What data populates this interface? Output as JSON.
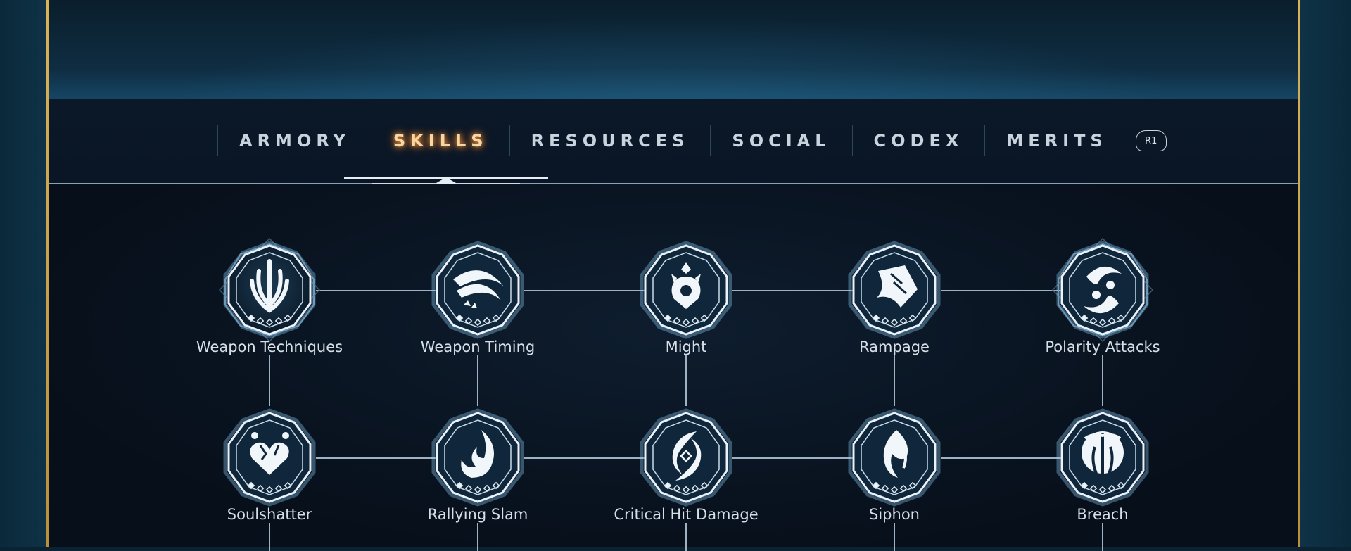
{
  "nav": {
    "tabs": [
      {
        "label": "ARMORY",
        "active": false
      },
      {
        "label": "SKILLS",
        "active": true
      },
      {
        "label": "RESOURCES",
        "active": false
      },
      {
        "label": "SOCIAL",
        "active": false
      },
      {
        "label": "CODEX",
        "active": false
      },
      {
        "label": "MERITS",
        "active": false
      }
    ],
    "next_button_label": "R1"
  },
  "skills": {
    "row1": [
      {
        "name": "Weapon Techniques",
        "icon": "trident-icon",
        "ornate": true,
        "pips_filled": 1,
        "pips_total": 5
      },
      {
        "name": "Weapon Timing",
        "icon": "slash-icon",
        "ornate": false,
        "pips_filled": 1,
        "pips_total": 5
      },
      {
        "name": "Might",
        "icon": "lion-crest-icon",
        "ornate": false,
        "pips_filled": 1,
        "pips_total": 5
      },
      {
        "name": "Rampage",
        "icon": "claw-burst-icon",
        "ornate": false,
        "pips_filled": 1,
        "pips_total": 5
      },
      {
        "name": "Polarity Attacks",
        "icon": "yin-yang-swirl-icon",
        "ornate": true,
        "pips_filled": 1,
        "pips_total": 5
      }
    ],
    "row2": [
      {
        "name": "Soulshatter",
        "icon": "shattered-heart-icon",
        "ornate": false,
        "pips_filled": 1,
        "pips_total": 5
      },
      {
        "name": "Rallying Slam",
        "icon": "flame-swirl-icon",
        "ornate": false,
        "pips_filled": 1,
        "pips_total": 5
      },
      {
        "name": "Critical Hit Damage",
        "icon": "vortex-eye-icon",
        "ornate": false,
        "pips_filled": 1,
        "pips_total": 5
      },
      {
        "name": "Siphon",
        "icon": "flame-curl-icon",
        "ornate": false,
        "pips_filled": 1,
        "pips_total": 5
      },
      {
        "name": "Breach",
        "icon": "split-orb-icon",
        "ornate": false,
        "pips_filled": 1,
        "pips_total": 5
      }
    ]
  },
  "colors": {
    "frame_gold": "#d8b35a",
    "active_tab": "#f7d6a6",
    "active_glow": "#ff9a3a",
    "badge_glow": "#8fd3ff"
  }
}
